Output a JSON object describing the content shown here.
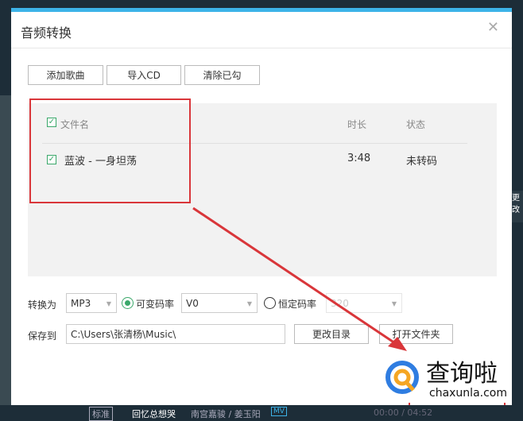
{
  "dialog": {
    "title": "音频转换",
    "close_icon": "close-icon"
  },
  "toolbar": {
    "add": "添加歌曲",
    "import_cd": "导入CD",
    "clear": "清除已勾"
  },
  "list": {
    "headers": {
      "name": "文件名",
      "duration": "时长",
      "status": "状态"
    },
    "rows": [
      {
        "name": "蓝波 - 一身坦荡",
        "duration": "3:48",
        "status": "未转码",
        "checked": true
      }
    ]
  },
  "convert": {
    "label": "转换为",
    "format": "MP3",
    "vbr_label": "可变码率",
    "vbr_value": "V0",
    "cbr_label": "恒定码率",
    "cbr_value": "320",
    "mode": "vbr"
  },
  "save": {
    "label": "保存到",
    "path": "C:\\Users\\张清杨\\Music\\",
    "change_dir": "更改目录",
    "open_folder": "打开文件夹"
  },
  "player": {
    "quality": "标准",
    "song": "回忆总想哭",
    "artist": "南宫嘉骏 / 姜玉阳",
    "mv": "MV",
    "time": "00:00 / 04:52"
  },
  "background": {
    "side_text": "更改"
  },
  "watermark": {
    "brand": "查询啦",
    "url": "chaxunla.com"
  },
  "colors": {
    "accent": "#3db3e8",
    "check": "#3aa86a",
    "annotation": "#d9363a"
  }
}
